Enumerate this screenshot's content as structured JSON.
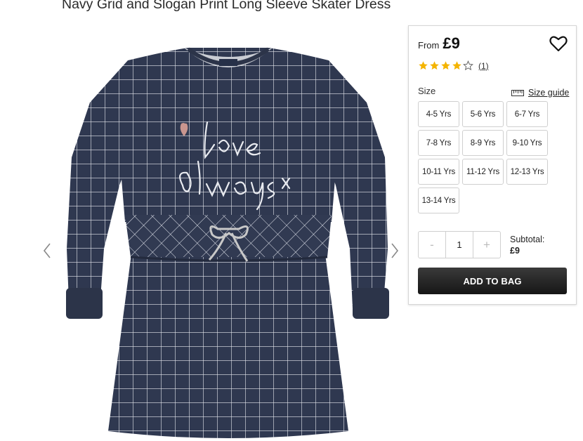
{
  "product": {
    "title": "Navy Grid and Slogan Print Long Sleeve Skater Dress",
    "image_alt": "love always x"
  },
  "gallery": {
    "prev_icon": "chevron-left-icon",
    "next_icon": "chevron-right-icon"
  },
  "buy_box": {
    "price_prefix": "From",
    "price": "£9",
    "wishlist_icon": "heart-icon",
    "rating": {
      "value": 4,
      "max": 5,
      "review_count": "(1)"
    },
    "size_label": "Size",
    "size_guide_label": "Size guide",
    "size_guide_icon": "ruler-icon",
    "sizes": [
      "4-5 Yrs",
      "5-6 Yrs",
      "6-7 Yrs",
      "7-8 Yrs",
      "8-9 Yrs",
      "9-10 Yrs",
      "10-11 Yrs",
      "11-12 Yrs",
      "12-13 Yrs",
      "13-14 Yrs"
    ],
    "quantity": {
      "minus": "-",
      "value": "1",
      "plus": "+"
    },
    "subtotal_label": "Subtotal:",
    "subtotal_value": "£9",
    "add_to_bag": "ADD TO BAG"
  },
  "colors": {
    "star": "#f4b400",
    "button": "#222222",
    "dress": "#2f3850"
  }
}
